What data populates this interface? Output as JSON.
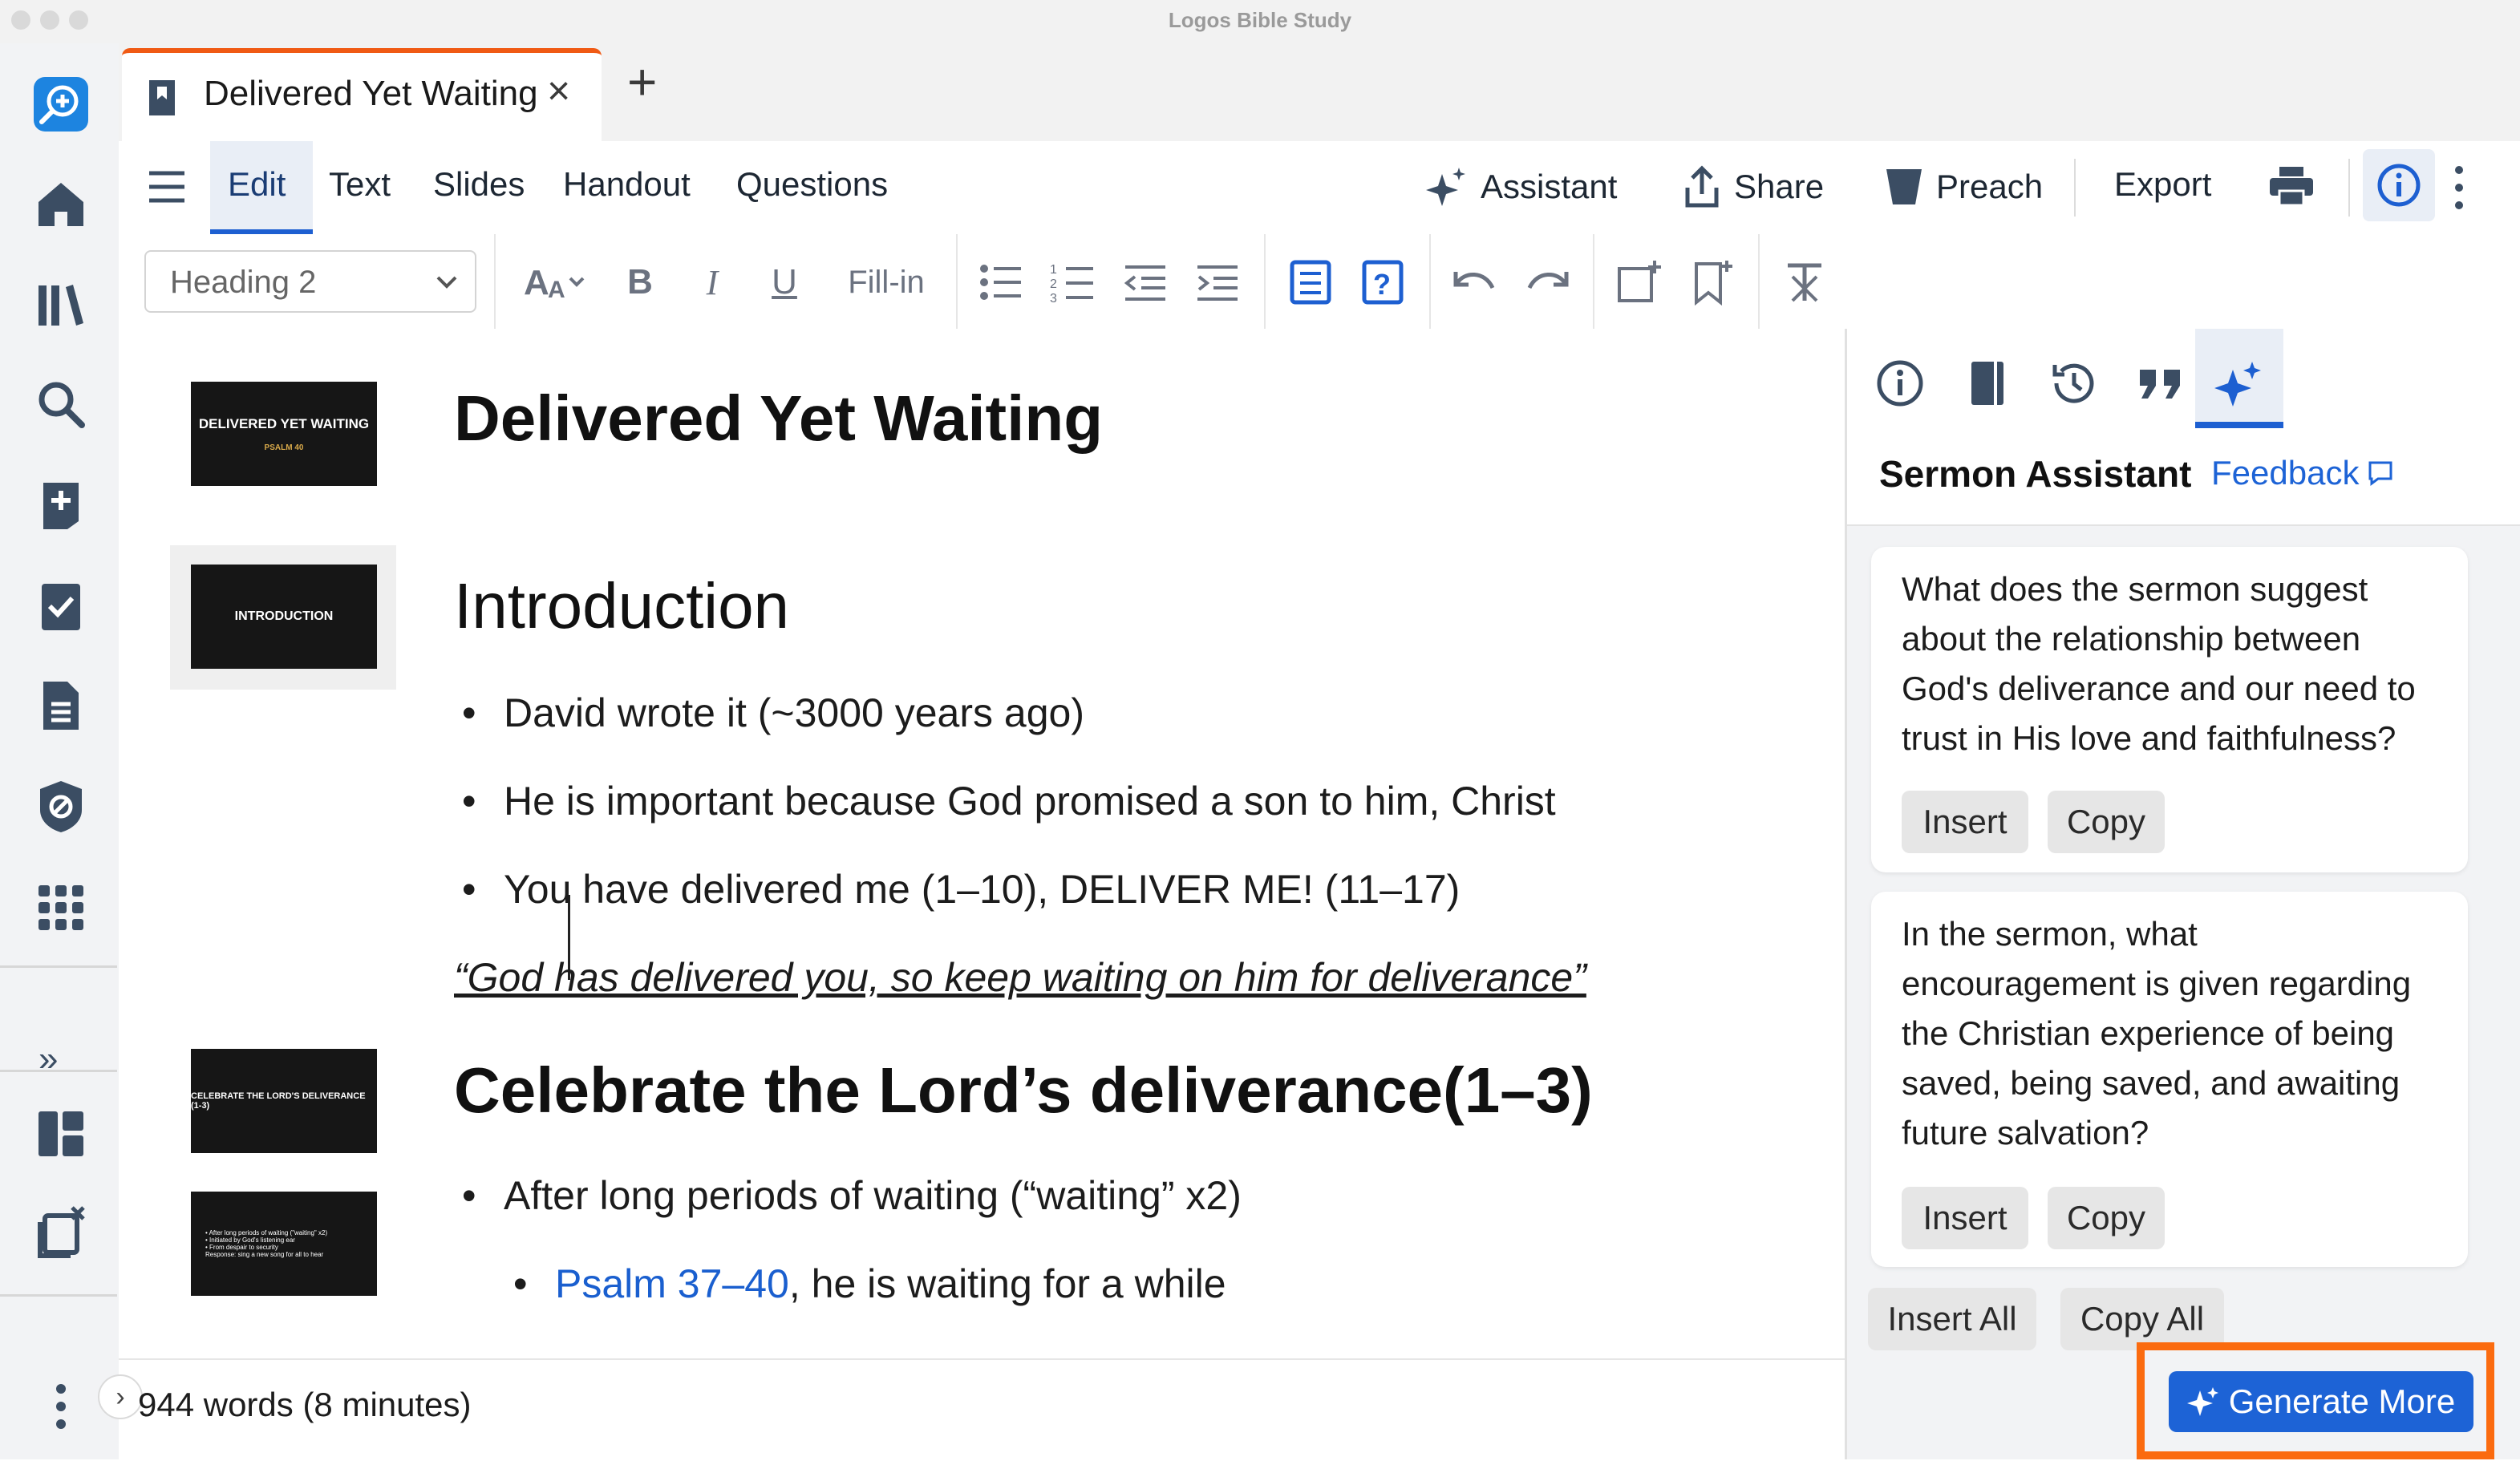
{
  "window": {
    "title": "Logos Bible Study"
  },
  "rail": {
    "items": [
      "logos-icon",
      "home-icon",
      "library-icon",
      "search-icon",
      "add-note-icon",
      "reading-plan-icon",
      "document-icon",
      "atlas-icon",
      "apps-grid-icon"
    ],
    "expand_label": "»",
    "bottom_items": [
      "layouts-icon",
      "close-panels-icon",
      "more-icon"
    ]
  },
  "tab": {
    "title": "Delivered Yet Waiting",
    "close": "×",
    "new": "+"
  },
  "menu": {
    "items": [
      "Edit",
      "Text",
      "Slides",
      "Handout",
      "Questions"
    ],
    "active": "Edit",
    "actions": {
      "assistant": "Assistant",
      "share": "Share",
      "preach": "Preach",
      "export": "Export"
    }
  },
  "toolbar": {
    "style_value": "Heading 2",
    "fillin_label": "Fill-in",
    "bold": "B",
    "italic": "I",
    "underline": "U"
  },
  "document": {
    "title": "Delivered Yet Waiting",
    "slides": [
      {
        "line1": "DELIVERED YET WAITING",
        "line2": "PSALM 40"
      },
      {
        "line1": "INTRODUCTION"
      },
      {
        "line1": "CELEBRATE THE LORD'S DELIVERANCE (1-3)"
      },
      {
        "lines": [
          "• After long periods of waiting (\"waiting\" x2)",
          "• Initiated by God's listening ear",
          "• From despair to security",
          "Response: sing a new song for all to hear"
        ]
      }
    ],
    "intro_heading": "Introduction",
    "intro_bullets": [
      "David wrote it (~3000 years ago)",
      "He is important because God promised a son to him, Christ",
      "You have delivered me (1–10), DELIVER ME! (11–17)"
    ],
    "quote": "“God has delivered you, so keep waiting on him for deliverance”",
    "section_heading": "Celebrate the Lord’s deliverance(1–3)",
    "section_bullet": "After long periods of waiting (“waiting” x2)",
    "sub_bullet_ref": "Psalm 37–40",
    "sub_bullet_text": ", he is waiting for a while"
  },
  "status": {
    "words": "944 words (8 minutes)",
    "toggle": "›"
  },
  "panel": {
    "tabs": [
      "info-icon",
      "notebook-icon",
      "history-icon",
      "quote-icon",
      "sparkle-icon"
    ],
    "title": "Sermon Assistant",
    "feedback": "Feedback",
    "questions": [
      {
        "text": "What does the sermon suggest about the relationship between God's deliverance and our need to trust in His love and faithfulness?",
        "insert": "Insert",
        "copy": "Copy"
      },
      {
        "text": "In the sermon, what encouragement is given regarding the Christian experience of being saved, being saved, and awaiting future salvation?",
        "insert": "Insert",
        "copy": "Copy"
      }
    ],
    "insert_all": "Insert All",
    "copy_all": "Copy All",
    "generate_more": "Generate More"
  },
  "colors": {
    "accent": "#1d63d6",
    "tab_accent": "#f05a14",
    "highlight": "#fb6b0f"
  }
}
